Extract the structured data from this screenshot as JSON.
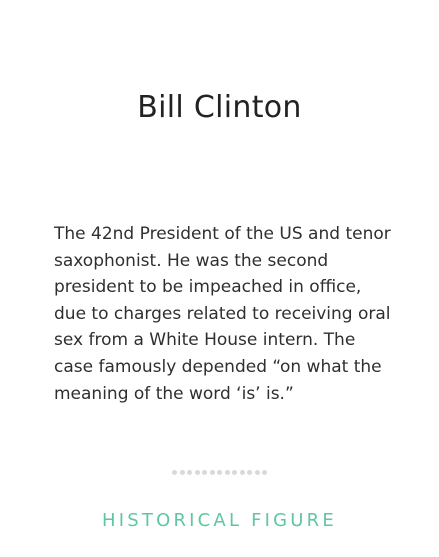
{
  "card": {
    "title": "Bill Clinton",
    "description": "The 42nd President of the US and tenor saxophonist. He was the second president to be impeached in office, due to charges related to receiving oral sex from a White House intern. The case famously depended “on what the meaning of the word ‘is’ is.”",
    "category": "HISTORICAL FIGURE",
    "pagination_dot_count": 13,
    "colors": {
      "accent": "#5fc7a0",
      "dot": "#d9d9d9",
      "text": "#2f2f2f"
    }
  }
}
